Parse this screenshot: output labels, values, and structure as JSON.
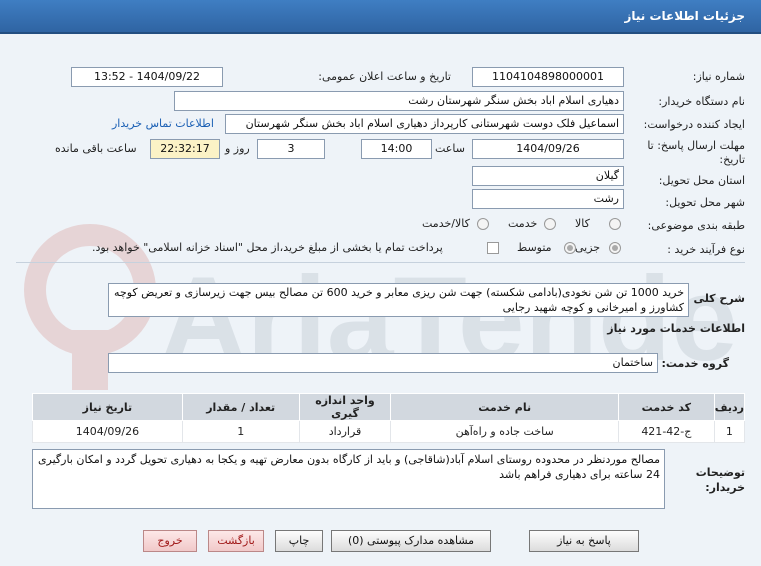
{
  "header": {
    "title": "جزئیات اطلاعات نیاز"
  },
  "fields": {
    "need_number": {
      "label": "شماره نیاز:",
      "value": "1104104898000001"
    },
    "announce_datetime": {
      "label": "تاریخ و ساعت اعلان عمومی:",
      "value": "1404/09/22 - 13:52"
    },
    "buyer_org": {
      "label": "نام دستگاه خریدار:",
      "value": "دهیاری اسلام اباد بخش سنگر شهرستان رشت"
    },
    "creator": {
      "label": "ایجاد کننده درخواست:",
      "value": "اسماعیل فلک دوست شهرستانی کارپرداز دهیاری اسلام اباد بخش سنگر شهرستان",
      "contact_link": "اطلاعات تماس خریدار"
    },
    "deadline": {
      "label": "مهلت ارسال پاسخ: تا تاریخ:",
      "date": "1404/09/26",
      "time_label": "ساعت",
      "time": "14:00",
      "days": "3",
      "days_label": "روز و",
      "remaining": "22:32:17",
      "remaining_label": "ساعت باقی مانده"
    },
    "province": {
      "label": "استان محل تحویل:",
      "value": "گیلان"
    },
    "city": {
      "label": "شهر محل تحویل:",
      "value": "رشت"
    },
    "category": {
      "label": "طبقه بندی موضوعی:",
      "options": [
        "کالا",
        "خدمت",
        "کالا/خدمت"
      ],
      "selected": "خدمت"
    },
    "process": {
      "label": "نوع فرآیند خرید :",
      "options": [
        "جزیی",
        "متوسط"
      ],
      "selected": "جزیی",
      "payment_note": "پرداخت تمام یا بخشی از مبلغ خرید،از محل \"اسناد خزانه اسلامی\" خواهد بود."
    }
  },
  "description": {
    "label": "شرح کلی نیاز:",
    "text": "خرید 1000 تن شن نخودی(بادامی شکسته) جهت شن ریزی معابر و خرید 600 تن مصالح بیس جهت زیرسازی و تعریض کوچه کشاورز و امیرخانی و کوچه شهید رجایی"
  },
  "services": {
    "title": "اطلاعات خدمات مورد نیاز",
    "group_label": "گروه خدمت:",
    "group_value": "ساختمان",
    "columns": [
      "ردیف",
      "کد خدمت",
      "نام خدمت",
      "واحد اندازه گیری",
      "تعداد / مقدار",
      "تاریخ نیاز"
    ],
    "rows": [
      [
        "1",
        "ج-42-421",
        "ساخت جاده و راه‌آهن",
        "قرارداد",
        "1",
        "1404/09/26"
      ]
    ]
  },
  "buyer_notes": {
    "label": "توضیحات خریدار:",
    "text": "مصالح موردنظر در محدوده روستای اسلام آباد(شاقاجی) و باید از کارگاه بدون معارض تهیه و یکجا به دهیاری تحویل گردد و امکان بارگیری 24 ساعته برای دهیاری فراهم باشد"
  },
  "buttons": {
    "reply": "پاسخ به نیاز",
    "attachments": "مشاهده مدارک پیوستی (0)",
    "print": "چاپ",
    "back": "بازگشت",
    "exit": "خروج"
  },
  "watermark": {
    "text": "AriaTender.net"
  }
}
